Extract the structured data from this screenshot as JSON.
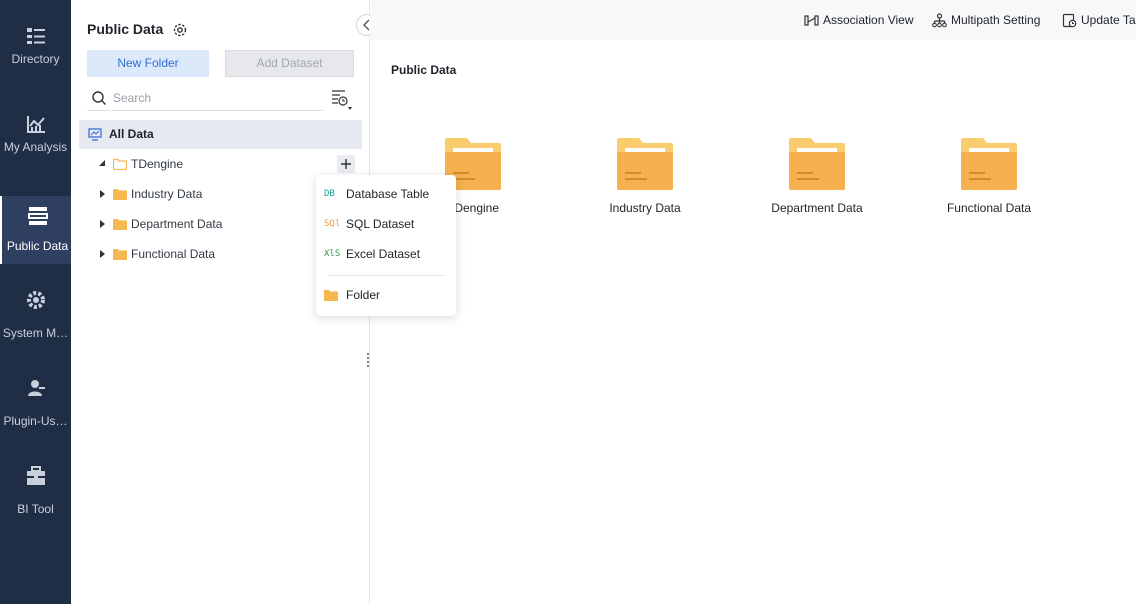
{
  "nav": {
    "items": [
      {
        "label": "Directory",
        "icon": "directory-icon"
      },
      {
        "label": "My Analysis",
        "icon": "analysis-icon"
      },
      {
        "label": "Public Data",
        "icon": "public-data-icon",
        "active": true
      },
      {
        "label": "System M…",
        "icon": "system-management-icon"
      },
      {
        "label": "Plugin-Us…",
        "icon": "plugin-user-icon"
      },
      {
        "label": "BI Tool",
        "icon": "toolbox-icon"
      }
    ]
  },
  "left_panel": {
    "title": "Public Data",
    "new_folder_label": "New Folder",
    "add_dataset_label": "Add Dataset",
    "search_placeholder": "Search",
    "tree": {
      "root_label": "All Data",
      "nodes": [
        {
          "label": "TDengine",
          "expanded": true
        },
        {
          "label": "Industry Data",
          "expanded": false
        },
        {
          "label": "Department Data",
          "expanded": false
        },
        {
          "label": "Functional Data",
          "expanded": false
        }
      ]
    }
  },
  "popup_menu": {
    "items": [
      {
        "label": "Database Table",
        "icon_text": "DB",
        "color": "#1aa39a"
      },
      {
        "label": "SQL Dataset",
        "icon_text": "SQl",
        "color": "#e89a3c"
      },
      {
        "label": "Excel Dataset",
        "icon_text": "XlS",
        "color": "#2f9a4a"
      },
      {
        "label": "Folder",
        "icon": "folder-icon"
      }
    ]
  },
  "toolbar": {
    "association_view_label": "Association View",
    "multipath_setting_label": "Multipath Setting",
    "update_label": "Update Ta"
  },
  "main": {
    "title": "Public Data",
    "folders": [
      "TDengine",
      "Industry Data",
      "Department Data",
      "Functional Data"
    ]
  },
  "colors": {
    "nav_bg": "#1f2d45",
    "folder_yellow": "#f5b750",
    "accent_blue": "#2f6fd6"
  }
}
